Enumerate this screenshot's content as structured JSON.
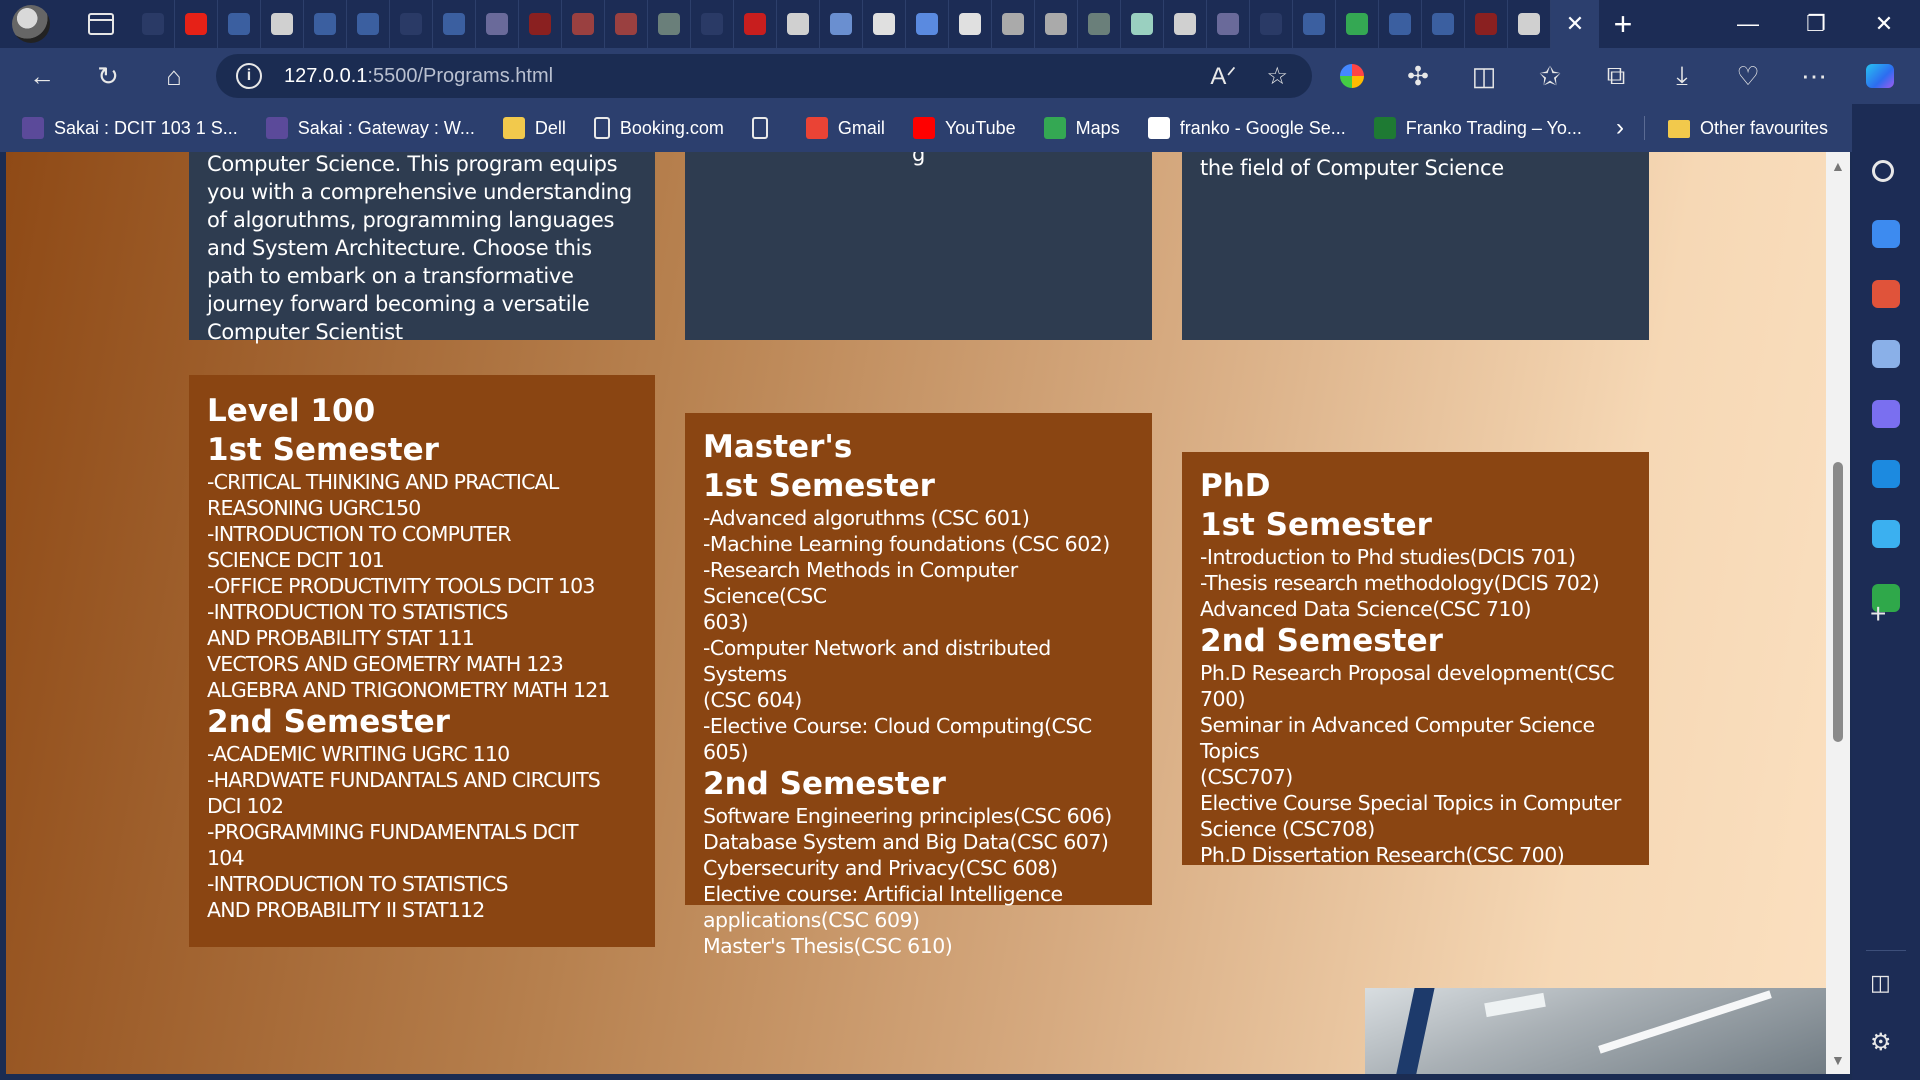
{
  "window": {
    "tab_close_label": "✕",
    "new_tab_label": "+",
    "minimize_label": "—",
    "restore_label": "❐",
    "close_label": "✕"
  },
  "tabs": {
    "icons": [
      {
        "name": "tab-blank-icon",
        "color": "#2a3a66"
      },
      {
        "name": "youtube-icon",
        "color": "#e62117"
      },
      {
        "name": "search-icon",
        "color": "#3b5fa0"
      },
      {
        "name": "github-icon",
        "color": "#d0d0d0"
      },
      {
        "name": "search-icon",
        "color": "#3b5fa0"
      },
      {
        "name": "search-icon",
        "color": "#3b5fa0"
      },
      {
        "name": "dots-icon",
        "color": "#2a3a66"
      },
      {
        "name": "search-icon",
        "color": "#3b5fa0"
      },
      {
        "name": "sakai-icon",
        "color": "#6a6a9a"
      },
      {
        "name": "youtube-icon",
        "color": "#8a2020"
      },
      {
        "name": "pdf-icon",
        "color": "#9a4040"
      },
      {
        "name": "pdf-icon",
        "color": "#9a4040"
      },
      {
        "name": "chatgpt-icon",
        "color": "#6a7f7a"
      },
      {
        "name": "dots-icon",
        "color": "#2a3a66"
      },
      {
        "name": "youtube-icon",
        "color": "#c81e1e"
      },
      {
        "name": "page-icon",
        "color": "#d0d0d0"
      },
      {
        "name": "flag-icon",
        "color": "#6a8fd0"
      },
      {
        "name": "github-icon",
        "color": "#e0e0e0"
      },
      {
        "name": "docs-icon",
        "color": "#5a8ae0"
      },
      {
        "name": "github-icon",
        "color": "#e0e0e0"
      },
      {
        "name": "github-icon",
        "color": "#aaaaaa"
      },
      {
        "name": "github-icon",
        "color": "#aaaaaa"
      },
      {
        "name": "chatgpt-icon",
        "color": "#6a7f7a"
      },
      {
        "name": "chatgpt-icon",
        "color": "#9ad0c0"
      },
      {
        "name": "page-icon",
        "color": "#d0d0d0"
      },
      {
        "name": "sakai-icon",
        "color": "#6a6a9a"
      },
      {
        "name": "dots-icon",
        "color": "#2a3a66"
      },
      {
        "name": "search-icon",
        "color": "#3b5fa0"
      },
      {
        "name": "maps-icon",
        "color": "#34a853"
      },
      {
        "name": "search-icon",
        "color": "#3b5fa0"
      },
      {
        "name": "search-icon",
        "color": "#3b5fa0"
      },
      {
        "name": "youtube-icon",
        "color": "#8a2020"
      },
      {
        "name": "page-icon",
        "color": "#d0d0d0"
      }
    ]
  },
  "address_bar": {
    "url_host": "127.0.0.1",
    "url_path": ":5500/Programs.html"
  },
  "bookmarks": [
    {
      "label": "Sakai : DCIT 103 1 S...",
      "icon": "sakai-icon",
      "color": "#5b4a9a"
    },
    {
      "label": "Sakai : Gateway : W...",
      "icon": "sakai-icon",
      "color": "#5b4a9a"
    },
    {
      "label": "Dell",
      "icon": "folder-icon",
      "color": "#f2c94c"
    },
    {
      "label": "Booking.com",
      "icon": "page-icon",
      "color": "#2c3f6e"
    },
    {
      "label": "",
      "icon": "page-icon",
      "color": "#2c3f6e"
    },
    {
      "label": "Gmail",
      "icon": "gmail-icon",
      "color": "#ea4335"
    },
    {
      "label": "YouTube",
      "icon": "youtube-icon",
      "color": "#ff0000"
    },
    {
      "label": "Maps",
      "icon": "maps-icon",
      "color": "#34a853"
    },
    {
      "label": "franko - Google Se...",
      "icon": "google-icon",
      "color": "#ffffff"
    },
    {
      "label": "Franko Trading – Yo...",
      "icon": "franko-icon",
      "color": "#1e7a33"
    }
  ],
  "bookmarks_other": "Other favourites",
  "page": {
    "bachelor": {
      "desc": "Computer Science. This program equips you with a comprehensive understanding of algoruthms, programming languages and System Architecture. Choose this path to embark on a transformative journey forward becoming a versatile Computer Scientist"
    },
    "masters_desc_tail": "g",
    "phd_desc_tail": "the field of Computer Science",
    "level100": {
      "title": "Level 100",
      "sem1_title": "1st Semester",
      "sem1_courses": [
        "-CRITICAL THINKING AND PRACTICAL",
        "REASONING UGRC150",
        "-INTRODUCTION TO COMPUTER",
        "SCIENCE DCIT 101",
        "-OFFICE PRODUCTIVITY TOOLS DCIT 103",
        "-INTRODUCTION TO STATISTICS",
        "AND PROBABILITY STAT 111",
        "VECTORS AND GEOMETRY MATH 123",
        "ALGEBRA AND TRIGONOMETRY MATH 121"
      ],
      "sem2_title": "2nd Semester",
      "sem2_courses": [
        "-ACADEMIC WRITING UGRC 110",
        "-HARDWATE FUNDANTALS AND CIRCUITS",
        "DCI 102",
        "-PROGRAMMING FUNDAMENTALS DCIT",
        "104",
        "-INTRODUCTION TO STATISTICS",
        "AND PROBABILITY II STAT112"
      ]
    },
    "masters": {
      "title": "Master's",
      "sem1_title": "1st Semester",
      "sem1_courses": [
        "-Advanced algoruthms (CSC 601)",
        "-Machine Learning foundations (CSC 602)",
        "-Research Methods in Computer Science(CSC",
        "603)",
        "-Computer Network and distributed Systems",
        "(CSC 604)",
        "-Elective Course: Cloud Computing(CSC 605)"
      ],
      "sem2_title": "2nd Semester",
      "sem2_courses": [
        "Software Engineering principles(CSC 606)",
        "Database System and Big Data(CSC 607)",
        "Cybersecurity and Privacy(CSC 608)",
        "Elective course: Artificial Intelligence",
        "applications(CSC 609)",
        "Master's Thesis(CSC 610)"
      ]
    },
    "phd": {
      "title": "PhD",
      "sem1_title": "1st Semester",
      "sem1_courses": [
        "-Introduction to Phd studies(DCIS 701)",
        "-Thesis research methodology(DCIS 702)",
        "Advanced Data Science(CSC 710)"
      ],
      "sem2_title": "2nd Semester",
      "sem2_courses": [
        "Ph.D Research Proposal development(CSC",
        "700)",
        "Seminar in Advanced Computer Science Topics",
        "(CSC707)",
        "Elective Course Special Topics in Computer",
        "Science (CSC708)",
        "Ph.D Dissertation Research(CSC 700)"
      ]
    }
  },
  "sidebar": {
    "icons": [
      {
        "name": "search-icon",
        "color": "#e8e8e8"
      },
      {
        "name": "shopping-tag-icon",
        "color": "#3d8bf0"
      },
      {
        "name": "toolbox-icon",
        "color": "#e0533a"
      },
      {
        "name": "chess-icon",
        "color": "#8ab0e8"
      },
      {
        "name": "copilot-icon",
        "color": "#7a6ff0"
      },
      {
        "name": "outlook-icon",
        "color": "#1c8ae0"
      },
      {
        "name": "send-icon",
        "color": "#3bb0f0"
      },
      {
        "name": "tree-icon",
        "color": "#2fa84a"
      }
    ],
    "add_label": "+"
  }
}
